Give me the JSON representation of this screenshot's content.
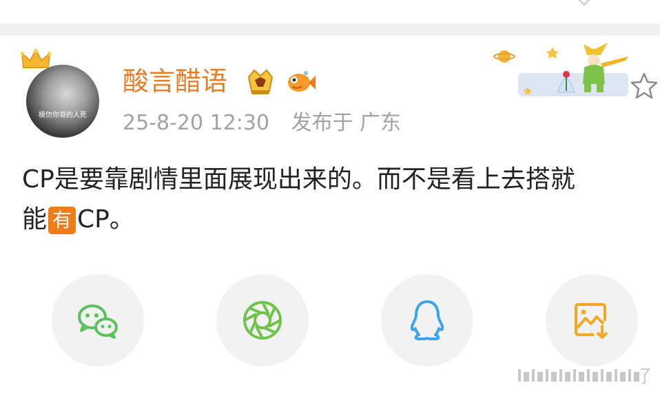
{
  "profile": {
    "username": "酸言醋语",
    "avatar_caption": "模仿你哥的人死",
    "date": "25-8-20 12:30",
    "location": "发布于 广东"
  },
  "post": {
    "line1": "CP是要靠剧情里面展现出来的。而不是看上去搭就",
    "line2_prefix": "能",
    "emoji_text": "有",
    "line2_suffix": "CP。"
  },
  "icons": {
    "crown": "crown-icon",
    "vip": "vip-badge-icon",
    "fish": "fish-badge-icon",
    "star": "star-icon",
    "share": [
      "wechat-icon",
      "moments-icon",
      "qq-icon",
      "save-image-icon"
    ]
  },
  "colors": {
    "username": "#ea7c28",
    "meta": "#a3a3a3",
    "wechat": "#59c25a",
    "moments": "#6fc24a",
    "qq": "#3aa3f0",
    "save": "#f5a623"
  }
}
